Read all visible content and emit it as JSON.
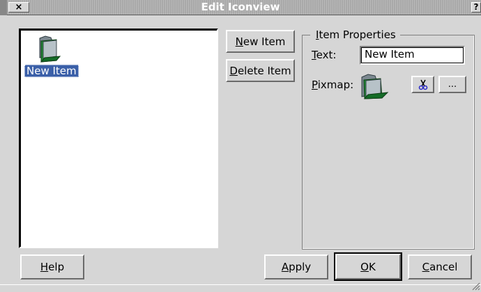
{
  "window": {
    "title": "Edit Iconview",
    "close_glyph": "×",
    "help_glyph": "?"
  },
  "iconview": {
    "items": [
      {
        "label": "New Item",
        "icon": "folder-icon",
        "selected": true
      }
    ]
  },
  "actions": {
    "new_item": {
      "mnemonic": "N",
      "rest": "ew Item"
    },
    "delete_item": {
      "mnemonic": "D",
      "rest": "elete Item"
    }
  },
  "properties": {
    "group_title": {
      "mnemonic": "I",
      "rest": "tem Properties"
    },
    "text_label": {
      "mnemonic": "T",
      "rest": "ext:"
    },
    "text_value": "New Item",
    "pixmap_label": {
      "mnemonic": "P",
      "rest": "ixmap:"
    },
    "pixmap_icon": "folder-icon",
    "clear_pixmap_icon": "scissors-icon",
    "browse_label": "..."
  },
  "footer": {
    "help": {
      "mnemonic": "H",
      "rest": "elp"
    },
    "apply": {
      "mnemonic": "A",
      "rest": "pply"
    },
    "ok": {
      "mnemonic": "O",
      "rest": "K"
    },
    "cancel": {
      "mnemonic": "C",
      "rest": "ancel"
    }
  },
  "colors": {
    "selection": "#3a5fa8",
    "folder_green": "#1a8a2a",
    "folder_gray": "#9aa4ac"
  }
}
